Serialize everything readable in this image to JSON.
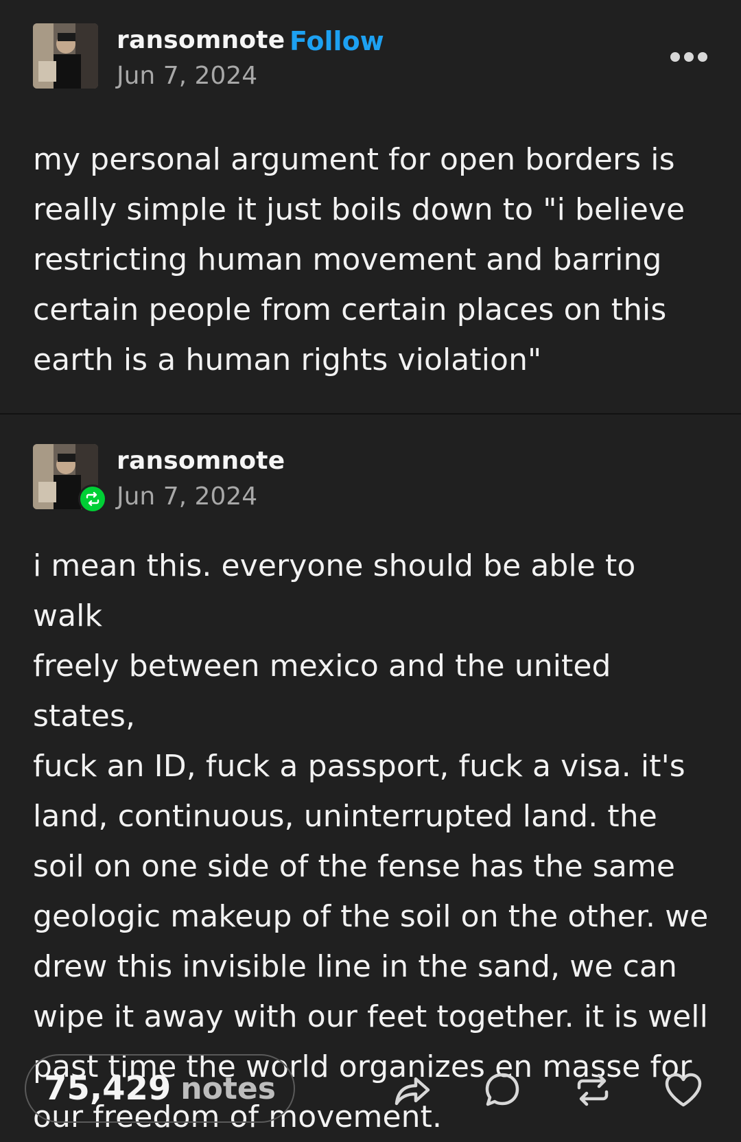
{
  "post": {
    "username": "ransomnote",
    "follow_label": "Follow",
    "date": "Jun 7, 2024",
    "body": "my personal argument for open borders is\nreally simple it just boils down to \"i believe\nrestricting human movement and barring\ncertain people from certain places on this\nearth is a human rights violation\""
  },
  "reblog": {
    "username": "ransomnote",
    "date": "Jun 7, 2024",
    "body": "i mean this. everyone should be able to walk\nfreely between mexico and the united states,\nfuck an ID, fuck a passport, fuck a visa. it's\nland, continuous, uninterrupted land. the\nsoil on one side of the fense has the same\ngeologic makeup of the soil on the other. we\ndrew this invisible line in the sand, we can\nwipe it away with our feet together. it is well\npast time the world organizes en masse for\nour freedom of movement."
  },
  "footer": {
    "notes_count": "75,429",
    "notes_label": "notes"
  },
  "icons": {
    "more": "more-horizontal-icon",
    "share": "share-icon",
    "reply": "reply-icon",
    "reblog": "reblog-icon",
    "like": "heart-icon"
  },
  "colors": {
    "background": "#202020",
    "follow": "#1da1f2",
    "reblog_badge": "#00cf35",
    "text": "#f2f2f2",
    "secondary_text": "#a8a8a8"
  }
}
